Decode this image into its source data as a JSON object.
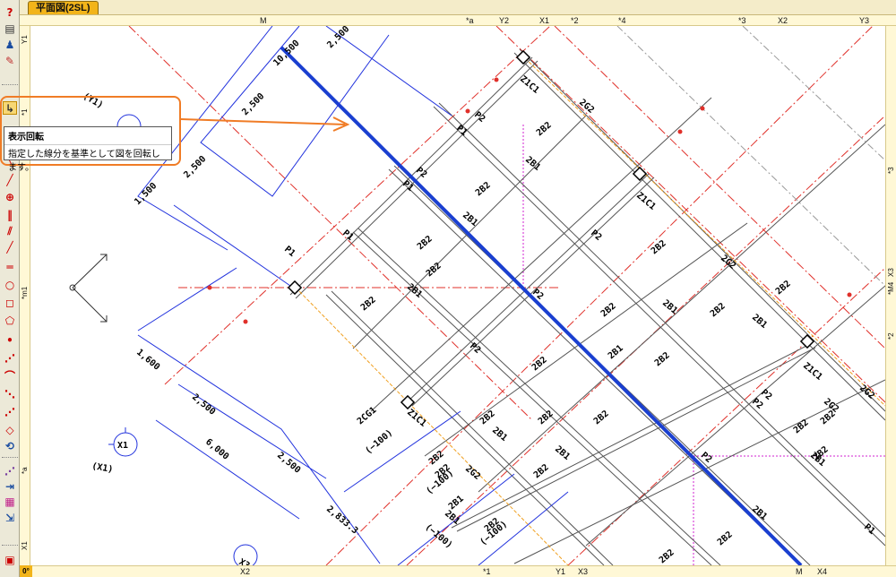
{
  "tab": {
    "label": "平面図(2SL)"
  },
  "toolbar": {
    "buttons": [
      "help-icon",
      "print-icon",
      "people-icon",
      "pen-icon",
      "rotate-view-icon",
      "line-icon",
      "diagonal-icon",
      "cross-icon",
      "double-line-icon",
      "multi-line-icon",
      "rect-icon",
      "circle-icon",
      "polygon-icon",
      "dot-icon",
      "slant-dash-icon",
      "arc-icon",
      "point-icon",
      "offset-icon",
      "loop-icon",
      "trim-icon",
      "extend-icon",
      "grid-icon",
      "move-icon",
      "fill-icon"
    ],
    "zoom": "0°"
  },
  "tooltip": {
    "title": "表示回転",
    "description": "指定した線分を基準として図を回転します。"
  },
  "ruler_top": [
    "M",
    "*a",
    "Y2",
    "X1",
    "*2",
    "*4",
    "*3",
    "X2",
    "Y3"
  ],
  "ruler_bottom": [
    "X2",
    "*1",
    "Y1",
    "X3",
    "M",
    "X4"
  ],
  "ruler_left": [
    "Y1",
    "*1",
    "*m1",
    "*a",
    "X1"
  ],
  "ruler_right": [
    "*3",
    "X3",
    "*M4",
    "*2"
  ],
  "drawing": {
    "dims": [
      "10,500",
      "2,500",
      "2,500",
      "2,500",
      "1,500",
      "1,600",
      "2,500",
      "6,000",
      "2,500",
      "2,833.3"
    ],
    "circle_labels": [
      "X1",
      "(X1)",
      "(Y1)",
      "X3"
    ],
    "members": [
      "Z1C1",
      "2G2",
      "P2",
      "P1",
      "2B2",
      "2B1",
      "P2",
      "P1",
      "2B2",
      "2B1",
      "2B2",
      "2B2",
      "2G2",
      "Z1C1",
      "P2",
      "P1",
      "2B2",
      "2B1",
      "2B1",
      "P2",
      "2B2",
      "2B2",
      "2B1",
      "2B1",
      "2B2",
      "2G2",
      "P2",
      "P2",
      "2B2",
      "2B2",
      "2B2",
      "2B2",
      "Z1C1",
      "2B1",
      "2B2",
      "2B2",
      "2B2",
      "2B1",
      "2B2",
      "2B1",
      "2G2",
      "2B2",
      "2B1",
      "P2",
      "2CG1",
      "Z1C1",
      "2B2",
      "2G2",
      "2B2",
      "2B1",
      "2B2",
      "P1",
      "2B2",
      "2B2",
      "P2",
      "P1",
      "2B1",
      "2B2"
    ],
    "offset_labels": [
      "(−100)",
      "(−100)",
      "(−100)",
      "(−100)"
    ]
  }
}
